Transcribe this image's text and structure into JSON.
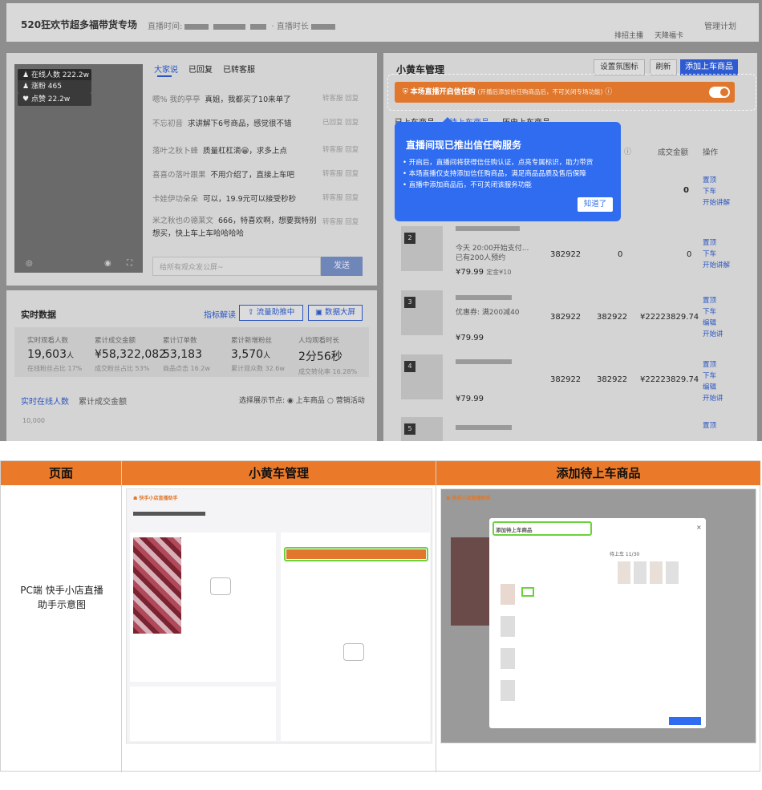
{
  "header": {
    "title": "520狂欢节超多福带货专场",
    "time_label": "直播时间:",
    "duration_label": "直播时长",
    "anchor_link": "排招主播",
    "card_link": "天降福卡",
    "plan_link": "管理计划"
  },
  "video": {
    "online": "在线人数 222.2w",
    "fans": "涨粉 465",
    "likes": "点赞 22.2w"
  },
  "comments": {
    "tabs": [
      "大家说",
      "已回复",
      "已转客服"
    ],
    "items": [
      {
        "user": "嗯% 我的亭亭",
        "text": "真姐，我都买了10来单了",
        "actions": "转客服  回复"
      },
      {
        "user": "不忘初音",
        "text": "求讲解下6号商品，感觉很不错",
        "actions": "已回复  回复"
      },
      {
        "user": "落叶之秋卜蜂",
        "text": "质量杠杠滴😀，求多上点",
        "actions": "转客服  回复"
      },
      {
        "user": "喜喜の落叶跟果",
        "text": "不用介绍了，直接上车吧",
        "actions": "转客服  回复"
      },
      {
        "user": "卡娃伊功朵朵",
        "text": "可以，19.9元可以接受秒秒",
        "actions": "转客服  回复"
      },
      {
        "user": "米之秋也の德莱文",
        "text": "666，特喜欢啊，想要我特别想买，快上车上车哈哈哈哈",
        "actions": "转客服  回复"
      }
    ],
    "input_placeholder": "给所有观众发公屏~",
    "send": "发送"
  },
  "realtime": {
    "title": "实时数据",
    "indicator": "指标解读",
    "flow_btn": "流量助推中",
    "screen_btn": "数据大屏",
    "stats": [
      {
        "label": "实时观看人数",
        "value": "19,603",
        "unit": "人",
        "sub": "在线粉丝占比 17%"
      },
      {
        "label": "累计成交金额",
        "value": "¥58,322,082",
        "unit": "",
        "sub": "成交粉丝占比 53%"
      },
      {
        "label": "累计订单数",
        "value": "53,183",
        "unit": "",
        "sub": "商品点击 16.2w"
      },
      {
        "label": "累计新增粉丝",
        "value": "3,570",
        "unit": "人",
        "sub": "累计观众数 32.6w"
      },
      {
        "label": "人均观看时长",
        "value": "2分56秒",
        "unit": "",
        "sub": "成交转化率 16.28%"
      }
    ],
    "chart_tabs": [
      "实时在线人数",
      "累计成交金额"
    ],
    "node_label": "选择展示节点:",
    "node_opts": [
      "上车商品",
      "营销活动"
    ],
    "ytick": "10,000"
  },
  "cart": {
    "title": "小黄车管理",
    "set_icon": "设置氛围标",
    "refresh": "刷新",
    "add": "添加上车商品",
    "trust_text": "本场直播开启信任购",
    "trust_sub": "(开播后添加信任购商品后，不可关闭专场功能)",
    "tabs": [
      "已上车商品",
      "待上车商品",
      "历史上车商品"
    ],
    "col_amount": "成交金额",
    "col_op": "操作",
    "popup": {
      "title": "直播间现已推出信任购服务",
      "items": [
        "开启后，直播间将获得信任购认证，点亮专属标识，助力带货",
        "本场直播仅支持添加信任购商品，满足商品品质及售后保障",
        "直播中添加商品后，不可关闭该服务功能"
      ],
      "ok": "知道了"
    },
    "rows": [
      {
        "num": "2",
        "meta1": "今天 20:00开始支付...",
        "meta2": "已有200人预约",
        "price": "¥79.99",
        "tag": "定金¥10",
        "c1": "382922",
        "c2": "0",
        "c3": "0",
        "ops": [
          "置顶",
          "下车",
          "开始讲解"
        ]
      },
      {
        "num": "3",
        "meta1": "优惠券: 满200减40",
        "meta2": "",
        "price": "¥79.99",
        "tag": "",
        "c1": "382922",
        "c2": "382922",
        "c3": "¥22223829.74",
        "ops": [
          "置顶",
          "下车",
          "编辑",
          "开始讲"
        ]
      },
      {
        "num": "4",
        "meta1": "",
        "meta2": "",
        "price": "¥79.99",
        "tag": "",
        "c1": "382922",
        "c2": "382922",
        "c3": "¥22223829.74",
        "ops": [
          "置顶",
          "下车",
          "编辑",
          "开始讲"
        ]
      },
      {
        "num": "5",
        "meta1": "",
        "meta2": "",
        "price": "",
        "tag": "",
        "c1": "",
        "c2": "",
        "c3": "",
        "ops": [
          "置顶"
        ]
      }
    ],
    "row0_c3": "0",
    "row0_ops": [
      "置顶",
      "下车",
      "开始讲解"
    ]
  },
  "table": {
    "headers": [
      "页面",
      "小黄车管理",
      "添加待上车商品"
    ],
    "row_label": "PC端 快手小店直播助手示意图",
    "app_name": "快手小店直播助手",
    "dialog_title": "添加待上车商品",
    "selected_label": "待上车 11/30"
  },
  "colors": {
    "orange": "#ea7a2a",
    "blue": "#2f6cf0",
    "green": "#6bd23c"
  }
}
